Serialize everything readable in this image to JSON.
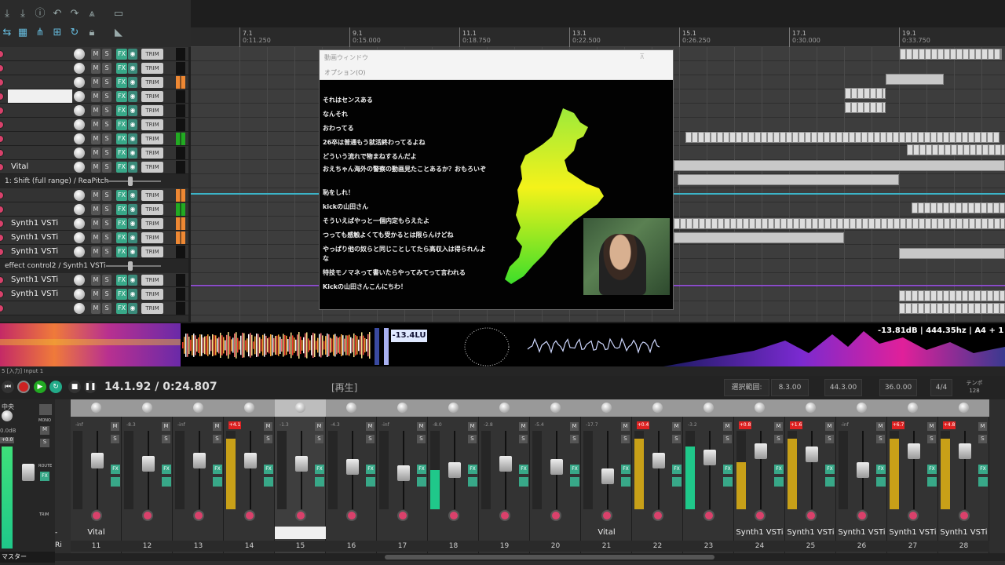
{
  "ruler": {
    "marks": [
      {
        "bar": "7.1",
        "time": "0:11.250"
      },
      {
        "bar": "9.1",
        "time": "0:15.000"
      },
      {
        "bar": "11.1",
        "time": "0:18.750"
      },
      {
        "bar": "13.1",
        "time": "0:22.500"
      },
      {
        "bar": "15.1",
        "time": "0:26.250"
      },
      {
        "bar": "17.1",
        "time": "0:30.000"
      },
      {
        "bar": "19.1",
        "time": "0:33.750"
      }
    ]
  },
  "tracks": {
    "vital": "Vital",
    "env1": "1: Shift (full range) / ReaPitch",
    "synth1a": "Synth1 VSTi",
    "synth1b": "Synth1 VSTi",
    "synth1c": "Synth1 VSTi",
    "env2": "effect control2 / Synth1 VSTi",
    "synth1d": "Synth1 VSTi",
    "synth1e": "Synth1 VSTi",
    "m": "M",
    "s": "S",
    "fx": "FX",
    "trim": "TRIM"
  },
  "video_window": {
    "title": "動画ウィンドウ",
    "menu": "オプション(O)",
    "pin": "⊼",
    "chat": [
      "それはセンスある",
      "なんそれ",
      "おわってる",
      "26卒は普通もう就活終わってるよね",
      "どういう流れで物まねするんだよ",
      "おえちゃん海外の警察の動画見たことあるか？おもろいぞ",
      "恥をしれ！",
      "kickの山田さん",
      "そういえばやっと一個内定もらえたよ",
      "つっても感触よくても受かるとは限らんけどね",
      "やっぱり他の奴らと同じことしてたら高収入は得られんよな",
      "特技モノマネって書いたらやってみてって言われる",
      "Kickの山田さんこんにちわ！"
    ]
  },
  "analyzer": {
    "lufs": "-13.4LU",
    "readout": "-13.81dB | 444.35hz | A4 + 1"
  },
  "transport": {
    "header": "5 [入力] Input 1",
    "position": "14.1.92 / 0:24.807",
    "state": "[再生]",
    "sel_label": "選択範囲:",
    "sel_start": "8.3.00",
    "sel_end": "44.3.00",
    "sel_len": "36.0.00",
    "timesig": "4/4",
    "tempo_label": "テンポ",
    "tempo": "128"
  },
  "master": {
    "label": "マスター",
    "mono": "MONO",
    "route": "ROUTE",
    "trim": "TRIM",
    "db": "0.0dB",
    "peak": "+0.0",
    "center": "中央"
  },
  "mixer": {
    "strips": [
      {
        "num": "11",
        "name": "Vital",
        "peak": "-inf",
        "clip": false,
        "level": 0,
        "fader": 0.35
      },
      {
        "num": "12",
        "name": "",
        "peak": "-8.3",
        "clip": false,
        "level": 0,
        "fader": 0.4
      },
      {
        "num": "13",
        "name": "",
        "peak": "-inf",
        "clip": false,
        "level": 0,
        "fader": 0.35
      },
      {
        "num": "14",
        "name": "",
        "peak": "+4.1",
        "clip": true,
        "level": 0.9,
        "fader": 0.35
      },
      {
        "num": "15",
        "name": "",
        "peak": "-1.3",
        "clip": false,
        "level": 0,
        "fader": 0.4
      },
      {
        "num": "16",
        "name": "",
        "peak": "-4.3",
        "clip": false,
        "level": 0,
        "fader": 0.45
      },
      {
        "num": "17",
        "name": "",
        "peak": "-inf",
        "clip": false,
        "level": 0,
        "fader": 0.55
      },
      {
        "num": "18",
        "name": "",
        "peak": "-8.0",
        "clip": false,
        "level": 0.5,
        "fader": 0.5
      },
      {
        "num": "19",
        "name": "",
        "peak": "-2.8",
        "clip": false,
        "level": 0,
        "fader": 0.4
      },
      {
        "num": "20",
        "name": "",
        "peak": "-5.4",
        "clip": false,
        "level": 0,
        "fader": 0.45
      },
      {
        "num": "21",
        "name": "Vital",
        "peak": "-17.7",
        "clip": false,
        "level": 0,
        "fader": 0.6
      },
      {
        "num": "22",
        "name": "",
        "peak": "+0.4",
        "clip": true,
        "level": 0.9,
        "fader": 0.35
      },
      {
        "num": "23",
        "name": "",
        "peak": "-3.2",
        "clip": false,
        "level": 0.8,
        "fader": 0.3
      },
      {
        "num": "24",
        "name": "Synth1 VSTi",
        "peak": "+0.8",
        "clip": true,
        "level": 0.6,
        "fader": 0.2
      },
      {
        "num": "25",
        "name": "Synth1 VSTi",
        "peak": "+1.6",
        "clip": true,
        "level": 0.9,
        "fader": 0.25
      },
      {
        "num": "26",
        "name": "Synth1 VSTi",
        "peak": "-inf",
        "clip": false,
        "level": 0,
        "fader": 0.5
      },
      {
        "num": "27",
        "name": "Synth1 VSTi",
        "peak": "+6.7",
        "clip": true,
        "level": 0.9,
        "fader": 0.2
      },
      {
        "num": "28",
        "name": "Synth1 VSTi",
        "peak": "+4.8",
        "clip": true,
        "level": 0.9,
        "fader": 0.2
      }
    ],
    "partial_left_name": "- Ri"
  },
  "colors": {
    "accent": "#38a888",
    "rec": "#d9416b",
    "env": "#3bb4c8",
    "clip": "#d22222"
  }
}
